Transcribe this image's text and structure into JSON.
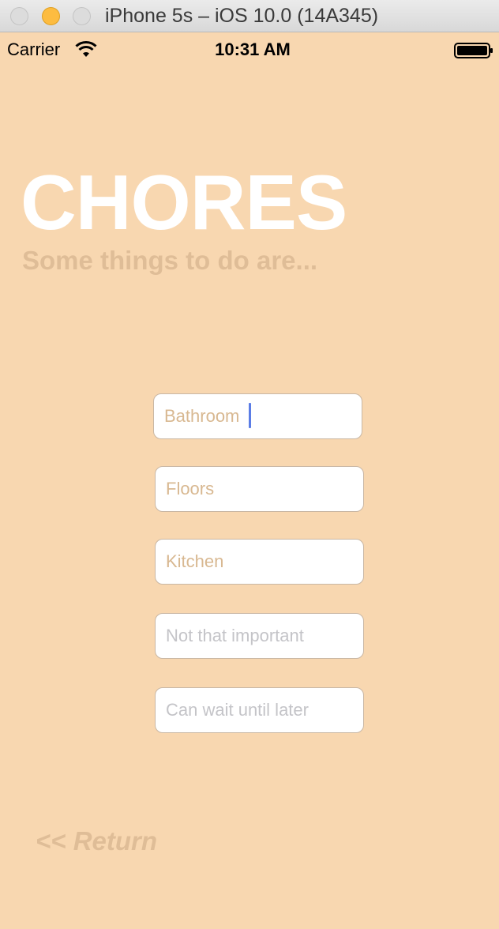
{
  "window": {
    "title": "iPhone 5s – iOS 10.0 (14A345)"
  },
  "status_bar": {
    "carrier": "Carrier",
    "time": "10:31 AM",
    "icons": [
      "wifi-icon",
      "battery-icon"
    ]
  },
  "screen": {
    "title": "CHORES",
    "subtitle": "Some things to do are...",
    "fields": [
      {
        "placeholder": "Bathroom",
        "focused": true
      },
      {
        "placeholder": "Floors"
      },
      {
        "placeholder": "Kitchen"
      },
      {
        "placeholder": "Not that important"
      },
      {
        "placeholder": "Can wait until later"
      }
    ],
    "return_label": "<< Return"
  },
  "colors": {
    "background": "#f8d7b0",
    "title": "#ffffff",
    "subtitle": "#dfbd97",
    "caret": "#5b7de6"
  }
}
